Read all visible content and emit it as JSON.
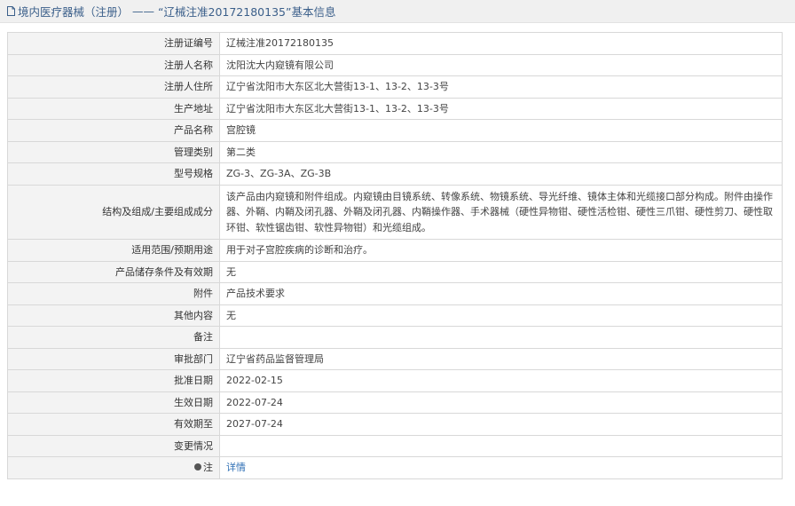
{
  "header": {
    "icon": "document-icon",
    "category": "境内医疗器械（注册）",
    "separator": "——",
    "record_title": "“辽械注准20172180135”基本信息"
  },
  "rows": [
    {
      "label": "注册证编号",
      "value": "辽械注准20172180135"
    },
    {
      "label": "注册人名称",
      "value": "沈阳沈大内窥镜有限公司"
    },
    {
      "label": "注册人住所",
      "value": "辽宁省沈阳市大东区北大营街13-1、13-2、13-3号"
    },
    {
      "label": "生产地址",
      "value": "辽宁省沈阳市大东区北大营街13-1、13-2、13-3号"
    },
    {
      "label": "产品名称",
      "value": "宫腔镜"
    },
    {
      "label": "管理类别",
      "value": "第二类"
    },
    {
      "label": "型号规格",
      "value": "ZG-3、ZG-3A、ZG-3B"
    },
    {
      "label": "结构及组成/主要组成成分",
      "value": "该产品由内窥镜和附件组成。内窥镜由目镜系统、转像系统、物镜系统、导光纤维、镜体主体和光缆接口部分构成。附件由操作器、外鞘、内鞘及闭孔器、外鞘及闭孔器、内鞘操作器、手术器械（硬性异物钳、硬性活检钳、硬性三爪钳、硬性剪刀、硬性取环钳、软性锯齿钳、软性异物钳）和光缆组成。"
    },
    {
      "label": "适用范围/预期用途",
      "value": "用于对子宫腔疾病的诊断和治疗。"
    },
    {
      "label": "产品储存条件及有效期",
      "value": "无"
    },
    {
      "label": "附件",
      "value": "产品技术要求"
    },
    {
      "label": "其他内容",
      "value": "无"
    },
    {
      "label": "备注",
      "value": ""
    },
    {
      "label": "审批部门",
      "value": "辽宁省药品监督管理局"
    },
    {
      "label": "批准日期",
      "value": "2022-02-15"
    },
    {
      "label": "生效日期",
      "value": "2022-07-24"
    },
    {
      "label": "有效期至",
      "value": "2027-07-24"
    },
    {
      "label": "变更情况",
      "value": ""
    }
  ],
  "note_row": {
    "label": "注",
    "icon": "note-icon",
    "link_text": "详情"
  }
}
